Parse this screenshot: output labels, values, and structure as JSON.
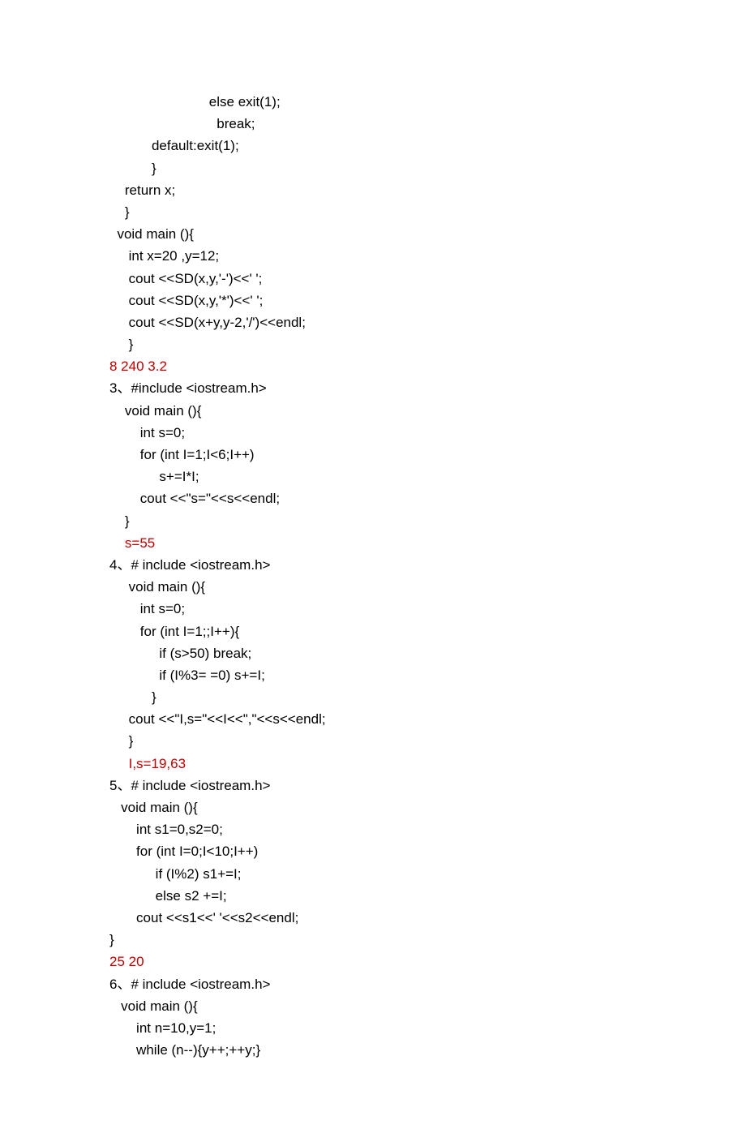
{
  "lines": [
    {
      "text": "                          else exit(1);",
      "cls": ""
    },
    {
      "text": "                            break;",
      "cls": ""
    },
    {
      "text": "           default:exit(1);",
      "cls": ""
    },
    {
      "text": "           }",
      "cls": ""
    },
    {
      "text": "    return x;",
      "cls": ""
    },
    {
      "text": "    }",
      "cls": ""
    },
    {
      "text": "  void main (){",
      "cls": ""
    },
    {
      "text": "     int x=20 ,y=12;",
      "cls": ""
    },
    {
      "text": "     cout <<SD(x,y,'-')<<' ';",
      "cls": ""
    },
    {
      "text": "     cout <<SD(x,y,'*')<<' ';",
      "cls": ""
    },
    {
      "text": "     cout <<SD(x+y,y-2,'/')<<endl;",
      "cls": ""
    },
    {
      "text": "     }",
      "cls": ""
    },
    {
      "text": "8 240 3.2",
      "cls": "red"
    },
    {
      "text": "3、#include <iostream.h>",
      "cls": ""
    },
    {
      "text": "    void main (){",
      "cls": ""
    },
    {
      "text": "        int s=0;",
      "cls": ""
    },
    {
      "text": "        for (int I=1;I<6;I++)",
      "cls": ""
    },
    {
      "text": "             s+=I*I;",
      "cls": ""
    },
    {
      "text": "        cout <<\"s=\"<<s<<endl;",
      "cls": ""
    },
    {
      "text": "    }",
      "cls": ""
    },
    {
      "text": "    s=55",
      "cls": "red"
    },
    {
      "text": "4、# include <iostream.h>",
      "cls": ""
    },
    {
      "text": "     void main (){",
      "cls": ""
    },
    {
      "text": "        int s=0;",
      "cls": ""
    },
    {
      "text": "        for (int I=1;;I++){",
      "cls": ""
    },
    {
      "text": "             if (s>50) break;",
      "cls": ""
    },
    {
      "text": "             if (I%3= =0) s+=I;",
      "cls": ""
    },
    {
      "text": "           }",
      "cls": ""
    },
    {
      "text": "     cout <<\"I,s=\"<<I<<\",\"<<s<<endl;",
      "cls": ""
    },
    {
      "text": "     }",
      "cls": ""
    },
    {
      "text": "     I,s=19,63",
      "cls": "red"
    },
    {
      "text": "5、# include <iostream.h>",
      "cls": ""
    },
    {
      "text": "   void main (){",
      "cls": ""
    },
    {
      "text": "       int s1=0,s2=0;",
      "cls": ""
    },
    {
      "text": "       for (int I=0;I<10;I++)",
      "cls": ""
    },
    {
      "text": "            if (I%2) s1+=I;",
      "cls": ""
    },
    {
      "text": "            else s2 +=I;",
      "cls": ""
    },
    {
      "text": "       cout <<s1<<' '<<s2<<endl;",
      "cls": ""
    },
    {
      "text": "}",
      "cls": ""
    },
    {
      "text": "25 20",
      "cls": "red"
    },
    {
      "text": "6、# include <iostream.h>",
      "cls": ""
    },
    {
      "text": "   void main (){",
      "cls": ""
    },
    {
      "text": "       int n=10,y=1;",
      "cls": ""
    },
    {
      "text": "       while (n--){y++;++y;}",
      "cls": ""
    }
  ]
}
